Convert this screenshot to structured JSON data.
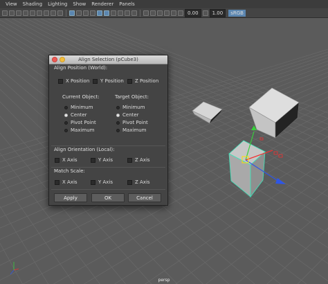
{
  "menu": {
    "items": [
      "View",
      "Shading",
      "Lighting",
      "Show",
      "Renderer",
      "Panels"
    ]
  },
  "toolbar": {
    "exposure": "0.00",
    "gamma": "1.00",
    "color_space": "sRGB"
  },
  "viewport": {
    "camera": "persp"
  },
  "dialog": {
    "title": "Align Selection (pCube3)",
    "position_heading": "Align Position (World):",
    "position_axes": [
      "X Position",
      "Y Position",
      "Z Position"
    ],
    "current_heading": "Current Object:",
    "target_heading": "Target Object:",
    "options": [
      "Minimum",
      "Center",
      "Pivot Point",
      "Maximum"
    ],
    "current_selected": "Center",
    "target_selected": "Center",
    "orientation_heading": "Align Orientation (Local):",
    "scale_heading": "Match Scale:",
    "axes": [
      "X Axis",
      "Y Axis",
      "Z Axis"
    ],
    "apply": "Apply",
    "ok": "OK",
    "cancel": "Cancel"
  },
  "colors": {
    "grid": "#6a6a6a",
    "selection": "#39e6b9",
    "accent": "#5b86b0"
  }
}
